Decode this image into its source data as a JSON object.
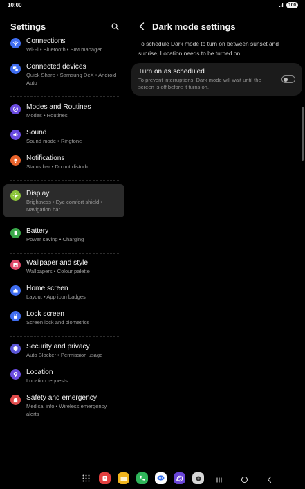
{
  "status": {
    "time": "10:00",
    "battery": "100"
  },
  "settings_title": "Settings",
  "menu": [
    {
      "key": "connections",
      "title": "Connections",
      "subtitle": "Wi-Fi  •  Bluetooth  •  SIM manager",
      "color": "#3f6df0",
      "icon": "wifi-icon"
    },
    {
      "key": "connected-devices",
      "title": "Connected devices",
      "subtitle": "Quick Share  •  Samsung DeX  •  Android Auto",
      "color": "#3f6df0",
      "icon": "devices-icon"
    },
    {
      "key": "modes-routines",
      "title": "Modes and Routines",
      "subtitle": "Modes  •  Routines",
      "color": "#6a4be0",
      "icon": "routines-icon"
    },
    {
      "key": "sound",
      "title": "Sound",
      "subtitle": "Sound mode  •  Ringtone",
      "color": "#6a4be0",
      "icon": "speaker-icon"
    },
    {
      "key": "notifications",
      "title": "Notifications",
      "subtitle": "Status bar  •  Do not disturb",
      "color": "#e8622a",
      "icon": "bell-icon"
    },
    {
      "key": "display",
      "title": "Display",
      "subtitle": "Brightness  •  Eye comfort shield  •  Navigation bar",
      "color": "#8cc43a",
      "icon": "sun-icon"
    },
    {
      "key": "battery",
      "title": "Battery",
      "subtitle": "Power saving  •  Charging",
      "color": "#3aa84a",
      "icon": "battery-icon"
    },
    {
      "key": "wallpaper",
      "title": "Wallpaper and style",
      "subtitle": "Wallpapers  •  Colour palette",
      "color": "#e04a6a",
      "icon": "wallpaper-icon"
    },
    {
      "key": "home-screen",
      "title": "Home screen",
      "subtitle": "Layout  •  App icon badges",
      "color": "#3f6df0",
      "icon": "home-icon"
    },
    {
      "key": "lock-screen",
      "title": "Lock screen",
      "subtitle": "Screen lock and biometrics",
      "color": "#3f6df0",
      "icon": "lock-icon"
    },
    {
      "key": "security",
      "title": "Security and privacy",
      "subtitle": "Auto Blocker  •  Permission usage",
      "color": "#5b56d6",
      "icon": "shield-icon"
    },
    {
      "key": "location",
      "title": "Location",
      "subtitle": "Location requests",
      "color": "#6a4be0",
      "icon": "location-icon"
    },
    {
      "key": "safety",
      "title": "Safety and emergency",
      "subtitle": "Medical info  •  Wireless emergency alerts",
      "color": "#e04a4a",
      "icon": "emergency-icon"
    }
  ],
  "detail": {
    "title": "Dark mode settings",
    "description": "To schedule Dark mode to turn on between sunset and sunrise, Location needs to be turned on.",
    "option": {
      "title": "Turn on as scheduled",
      "subtitle": "To prevent interruptions, Dark mode will wait until the screen is off before it turns on.",
      "enabled": false
    }
  },
  "dock_apps": [
    "apps-grid-icon",
    "samsung-notes-icon",
    "my-files-icon",
    "phone-icon",
    "messages-icon",
    "internet-icon",
    "camera-icon"
  ]
}
